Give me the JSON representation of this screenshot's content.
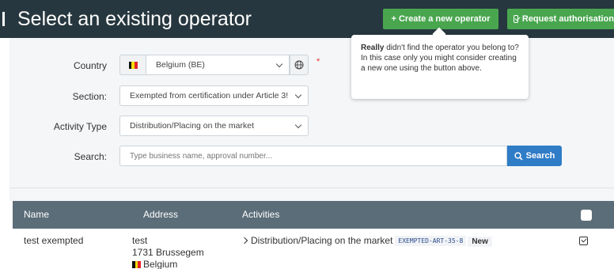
{
  "header": {
    "title": "Select an existing operator",
    "create_button": "+ Create a new operator",
    "auth_button": "Request authorisation"
  },
  "tooltip": {
    "bold": "Really",
    "text": " didn't find the operator you belong to? In this case only you might consider creating a new one using the button above."
  },
  "filters": {
    "country_label": "Country",
    "country_value": "Belgium (BE)",
    "section_label": "Section:",
    "section_value": "Exempted from certification under Article 3!",
    "activity_label": "Activity Type",
    "activity_value": "Distribution/Placing on the market",
    "search_label": "Search:",
    "search_placeholder": "Type business name, approval number...",
    "search_button": "Search",
    "required_mark": "*"
  },
  "colors": {
    "header_bg": "#27373f",
    "green": "#49a64f",
    "blue": "#2f7cc7",
    "table_head": "#5b6d78"
  },
  "table": {
    "columns": [
      "Name",
      "Address",
      "Activities"
    ],
    "rows": [
      {
        "name": "test exempted",
        "address_line1": "test",
        "address_line2": "1731 Brussegem",
        "address_country": "Belgium",
        "activity": "Distribution/Placing on the market",
        "code": "EXEMPTED-ART-35-8",
        "badge": "New"
      }
    ]
  },
  "icons": {
    "flag": "belgium-flag-icon",
    "globe": "globe-icon",
    "search": "search-icon",
    "check": "checkbox-check-icon",
    "chevron": "chevron-down-icon",
    "caret": "chevron-right-icon"
  }
}
